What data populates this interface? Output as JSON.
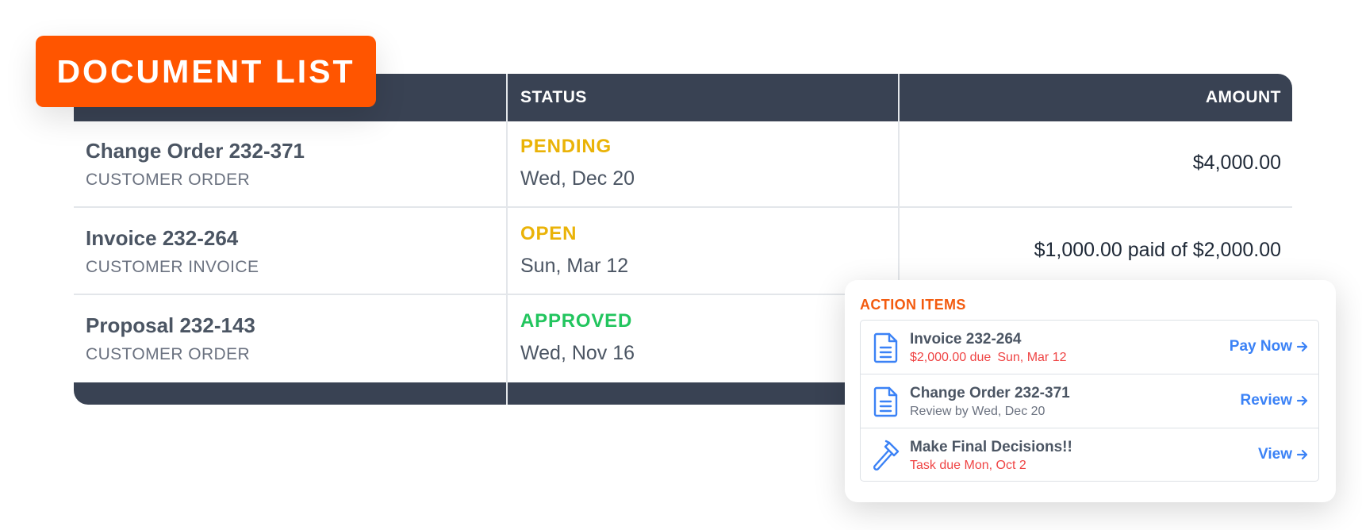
{
  "badge": {
    "label": "DOCUMENT LIST"
  },
  "table": {
    "headers": {
      "status": "STATUS",
      "amount": "AMOUNT"
    },
    "rows": [
      {
        "title": "Change Order 232-371",
        "type": "CUSTOMER ORDER",
        "status": "PENDING",
        "status_color": "#eab308",
        "date": "Wed, Dec 20",
        "amount": "$4,000.00"
      },
      {
        "title": "Invoice 232-264",
        "type": "CUSTOMER INVOICE",
        "status": "OPEN",
        "status_color": "#eab308",
        "date": "Sun, Mar 12",
        "amount": "$1,000.00 paid of $2,000.00"
      },
      {
        "title": "Proposal 232-143",
        "type": "CUSTOMER ORDER",
        "status": "APPROVED",
        "status_color": "#22c55e",
        "date": "Wed, Nov 16",
        "amount": ""
      }
    ]
  },
  "action_items": {
    "header": "ACTION ITEMS",
    "items": [
      {
        "icon": "document-icon",
        "title": "Invoice 232-264",
        "sub_a": "$2,000.00 due",
        "sub_b": "Sun, Mar 12",
        "action": "Pay Now"
      },
      {
        "icon": "document-icon",
        "title": "Change Order 232-371",
        "sub_a": "Review by Wed, Dec 20",
        "action": "Review"
      },
      {
        "icon": "hammer-icon",
        "title": "Make Final Decisions!!",
        "sub_a": "Task due Mon, Oct 2",
        "action": "View"
      }
    ]
  },
  "colors": {
    "header_bg": "#394253",
    "badge_bg": "#ff5500",
    "accent_blue": "#3b82f6",
    "due_red": "#ef4444",
    "pending_yellow": "#eab308",
    "approved_green": "#22c55e"
  }
}
